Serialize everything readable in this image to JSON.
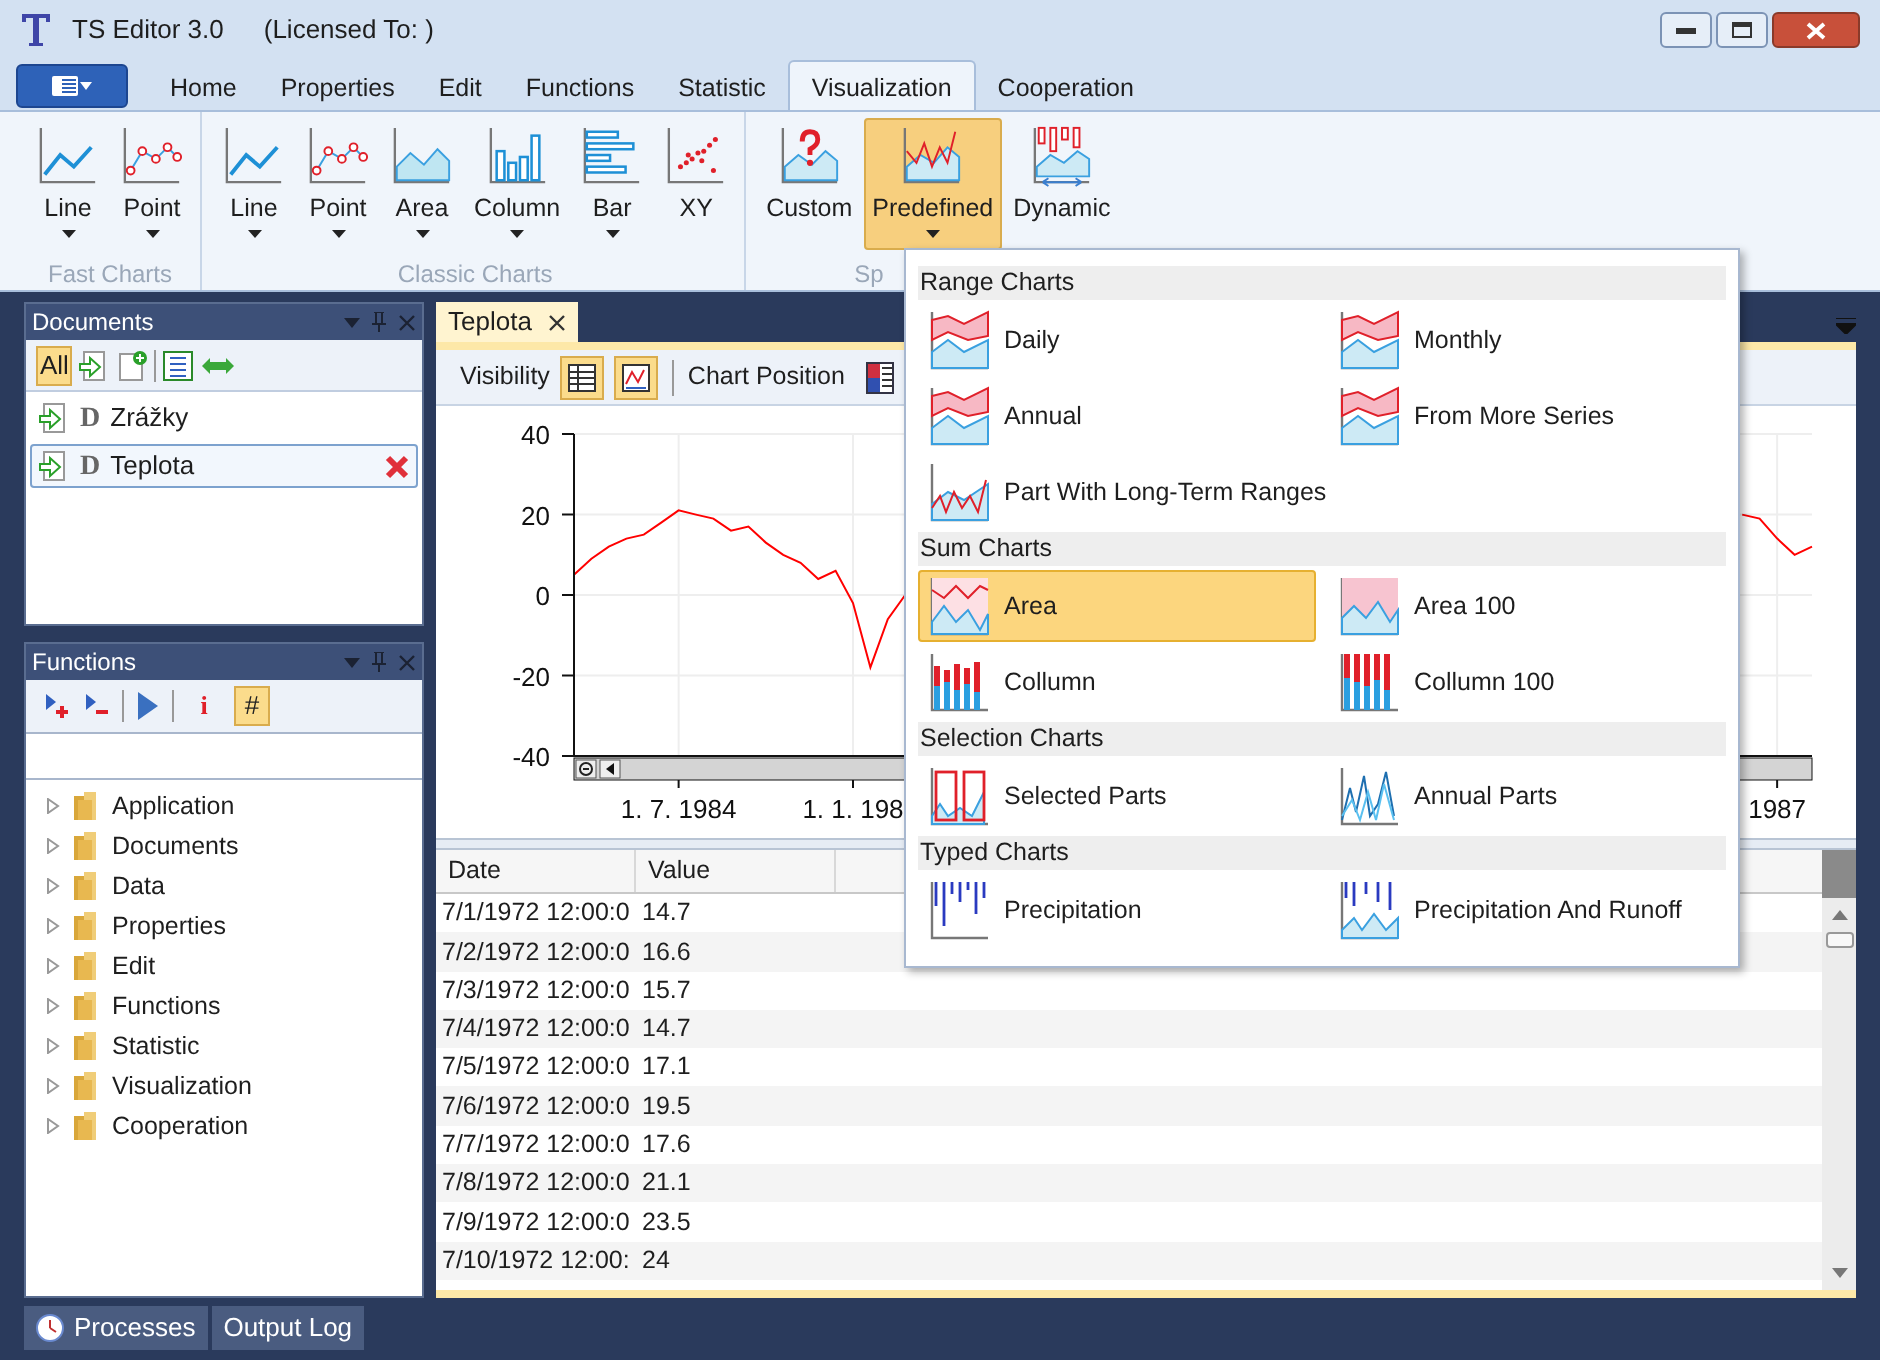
{
  "window": {
    "title": "TS Editor 3.0",
    "license": "(Licensed To: )"
  },
  "tabs": [
    {
      "label": "Home",
      "selected": false
    },
    {
      "label": "Properties",
      "selected": false
    },
    {
      "label": "Edit",
      "selected": false
    },
    {
      "label": "Functions",
      "selected": false
    },
    {
      "label": "Statistic",
      "selected": false
    },
    {
      "label": "Visualization",
      "selected": true
    },
    {
      "label": "Cooperation",
      "selected": false
    }
  ],
  "ribbon": {
    "groups": [
      {
        "label": "Fast Charts",
        "buttons": [
          {
            "label": "Line",
            "kind": "line",
            "dropdown": true,
            "selected": false
          },
          {
            "label": "Point",
            "kind": "point",
            "dropdown": true,
            "selected": false
          }
        ]
      },
      {
        "label": "Classic Charts",
        "buttons": [
          {
            "label": "Line",
            "kind": "line",
            "dropdown": true,
            "selected": false
          },
          {
            "label": "Point",
            "kind": "point",
            "dropdown": true,
            "selected": false
          },
          {
            "label": "Area",
            "kind": "area",
            "dropdown": true,
            "selected": false
          },
          {
            "label": "Column",
            "kind": "column",
            "dropdown": true,
            "selected": false
          },
          {
            "label": "Bar",
            "kind": "bar",
            "dropdown": true,
            "selected": false
          },
          {
            "label": "XY",
            "kind": "xy",
            "dropdown": false,
            "selected": false
          }
        ]
      },
      {
        "label": "Sp",
        "buttons": [
          {
            "label": "Custom",
            "kind": "custom",
            "dropdown": false,
            "selected": false
          },
          {
            "label": "Predefined",
            "kind": "predefined",
            "dropdown": true,
            "selected": true
          },
          {
            "label": "Dynamic",
            "kind": "dynamic",
            "dropdown": false,
            "selected": false
          }
        ]
      }
    ]
  },
  "documents_panel": {
    "title": "Documents",
    "filter": {
      "label": "All",
      "selected": true
    },
    "items": [
      {
        "type_letter": "D",
        "label": "Zrážky",
        "selected": false
      },
      {
        "type_letter": "D",
        "label": "Teplota",
        "selected": true
      }
    ]
  },
  "functions_panel": {
    "title": "Functions",
    "toolbar": [
      {
        "label": "i",
        "selected": false
      },
      {
        "label": "#",
        "selected": true
      }
    ],
    "tree": [
      {
        "label": "Application",
        "expanded": false
      },
      {
        "label": "Documents",
        "expanded": false
      },
      {
        "label": "Data",
        "expanded": false
      },
      {
        "label": "Properties",
        "expanded": false
      },
      {
        "label": "Edit",
        "expanded": false
      },
      {
        "label": "Functions",
        "expanded": false
      },
      {
        "label": "Statistic",
        "expanded": false
      },
      {
        "label": "Visualization",
        "expanded": false
      },
      {
        "label": "Cooperation",
        "expanded": false
      }
    ]
  },
  "editor": {
    "tab": "Teplota",
    "toolbar": {
      "visibility_label": "Visibility",
      "table_visible": true,
      "chart_visible": true,
      "position_label": "Chart Position"
    },
    "chart": {
      "chart_data": {
        "type": "line",
        "categories": [
          null,
          null,
          null,
          null,
          null,
          null,
          "1. 7. 1984",
          null,
          null,
          null,
          null,
          null,
          null,
          null,
          null,
          null,
          "1. 1. 198",
          null,
          null,
          null,
          null,
          null,
          null,
          null,
          null,
          null,
          null,
          null,
          null,
          null,
          null,
          null,
          null,
          null,
          null,
          null,
          null,
          null,
          null,
          null,
          null,
          null,
          null,
          null,
          null,
          null,
          null,
          null,
          null,
          null,
          null,
          null,
          null,
          null,
          null,
          null,
          null,
          null,
          null,
          null,
          null,
          null,
          null,
          null,
          null,
          null,
          null,
          null,
          null,
          "1987",
          null,
          null
        ],
        "series": [
          {
            "color": "#ff0000",
            "values": [
              5,
              9,
              12,
              14,
              15,
              18,
              21,
              20,
              19,
              16,
              17,
              13,
              10,
              8,
              4,
              6,
              -2,
              -18,
              -6,
              0,
              null,
              null,
              null,
              null,
              null,
              null,
              null,
              null,
              null,
              null,
              null,
              null,
              null,
              null,
              null,
              null,
              null,
              null,
              null,
              null,
              null,
              null,
              null,
              null,
              null,
              null,
              null,
              null,
              null,
              null,
              null,
              null,
              null,
              null,
              null,
              null,
              null,
              null,
              null,
              null,
              null,
              null,
              null,
              null,
              null,
              null,
              null,
              20,
              19,
              14,
              10,
              12
            ]
          }
        ],
        "ylim": [
          -40,
          40
        ],
        "grid": true,
        "yticks": [
          40,
          20,
          0,
          -20,
          -40
        ]
      }
    },
    "table": {
      "columns": [
        "Date",
        "Value"
      ],
      "rows": [
        [
          "7/1/1972 12:00:0",
          "14.7"
        ],
        [
          "7/2/1972 12:00:0",
          "16.6"
        ],
        [
          "7/3/1972 12:00:0",
          "15.7"
        ],
        [
          "7/4/1972 12:00:0",
          "14.7"
        ],
        [
          "7/5/1972 12:00:0",
          "17.1"
        ],
        [
          "7/6/1972 12:00:0",
          "19.5"
        ],
        [
          "7/7/1972 12:00:0",
          "17.6"
        ],
        [
          "7/8/1972 12:00:0",
          "21.1"
        ],
        [
          "7/9/1972 12:00:0",
          "23.5"
        ],
        [
          "7/10/1972 12:00:",
          "24"
        ]
      ]
    }
  },
  "predefined_menu": {
    "sections": [
      {
        "title": "Range Charts",
        "items": [
          {
            "label": "Daily",
            "kind": "range",
            "selected": false
          },
          {
            "label": "Monthly",
            "kind": "range",
            "selected": false
          },
          {
            "label": "Annual",
            "kind": "range",
            "selected": false
          },
          {
            "label": "From More Series",
            "kind": "range",
            "selected": false
          },
          {
            "label": "Part With Long-Term Ranges",
            "kind": "part",
            "selected": false
          }
        ]
      },
      {
        "title": "Sum Charts",
        "items": [
          {
            "label": "Area",
            "kind": "area",
            "selected": true
          },
          {
            "label": "Area 100",
            "kind": "area100",
            "selected": false
          },
          {
            "label": "Collumn",
            "kind": "column",
            "selected": false
          },
          {
            "label": "Collumn 100",
            "kind": "column100",
            "selected": false
          }
        ]
      },
      {
        "title": "Selection Charts",
        "items": [
          {
            "label": "Selected Parts",
            "kind": "selected",
            "selected": false
          },
          {
            "label": "Annual Parts",
            "kind": "annual",
            "selected": false
          }
        ]
      },
      {
        "title": "Typed Charts",
        "items": [
          {
            "label": "Precipitation",
            "kind": "precip",
            "selected": false
          },
          {
            "label": "Precipitation And Runoff",
            "kind": "runoff",
            "selected": false
          }
        ]
      }
    ]
  },
  "bottom_tabs": [
    {
      "label": "Processes",
      "selected": false
    },
    {
      "label": "Output Log",
      "selected": false
    }
  ]
}
